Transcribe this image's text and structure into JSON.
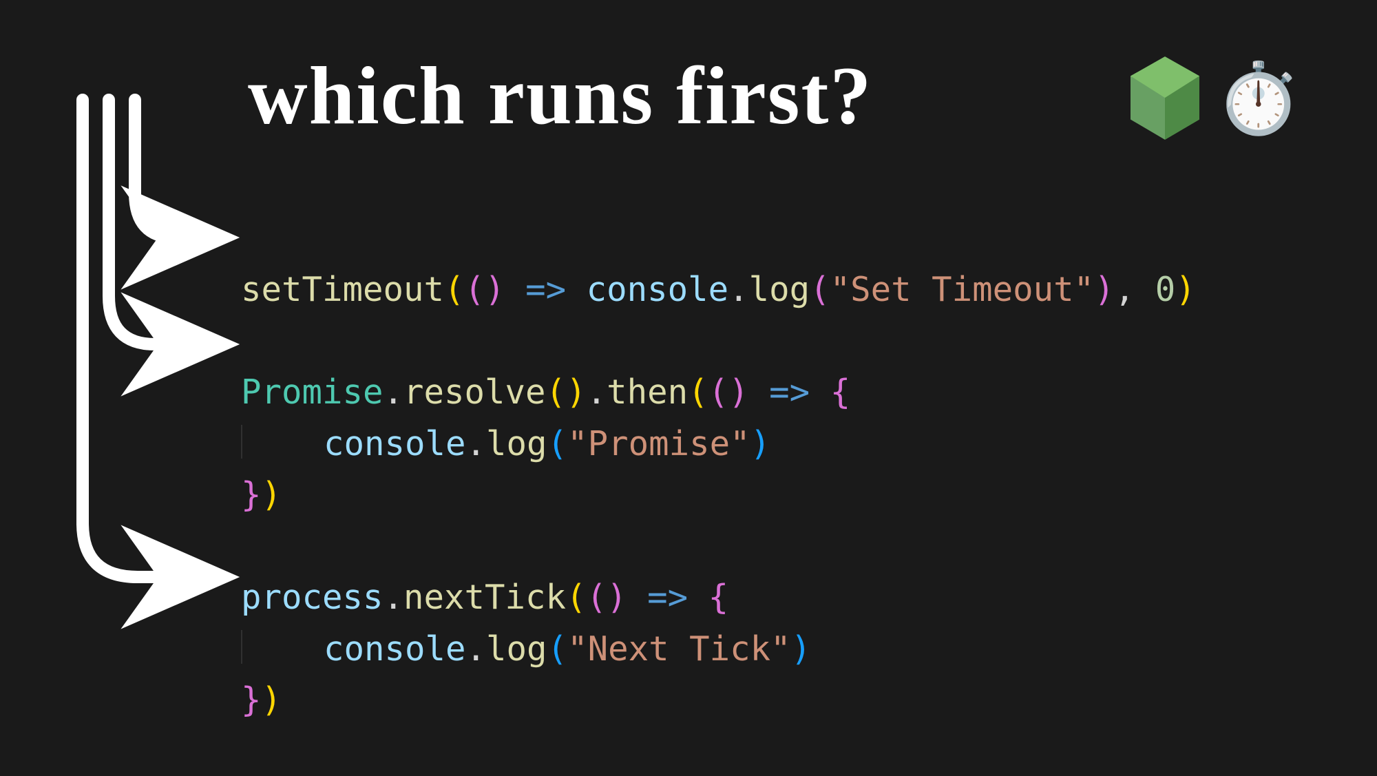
{
  "title": "which runs first?",
  "emoji": {
    "node_name": "node-logo",
    "stopwatch": "⏱️"
  },
  "code": {
    "line1": {
      "setTimeout": "setTimeout",
      "arrow": "=>",
      "console": "console",
      "log": "log",
      "str": "\"Set Timeout\"",
      "comma_zero": ", ",
      "zero": "0"
    },
    "line2": {
      "Promise": "Promise",
      "resolve": "resolve",
      "then": "then",
      "arrow": "=>",
      "console": "console",
      "log": "log",
      "str": "\"Promise\""
    },
    "line3": {
      "process": "process",
      "nextTick": "nextTick",
      "arrow": "=>",
      "console": "console",
      "log": "log",
      "str": "\"Next Tick\""
    }
  },
  "colors": {
    "bg": "#1a1a1a",
    "white": "#ffffff",
    "fn": "#dcdcaa",
    "class": "#4ec9b0",
    "var": "#9cdcfe",
    "str": "#ce9178",
    "num": "#b5cea8",
    "arrow_op": "#569cd6",
    "paren_yellow": "#ffd602",
    "paren_pink": "#da70d6",
    "paren_blue": "#179fff",
    "node_green": "#68a063"
  }
}
